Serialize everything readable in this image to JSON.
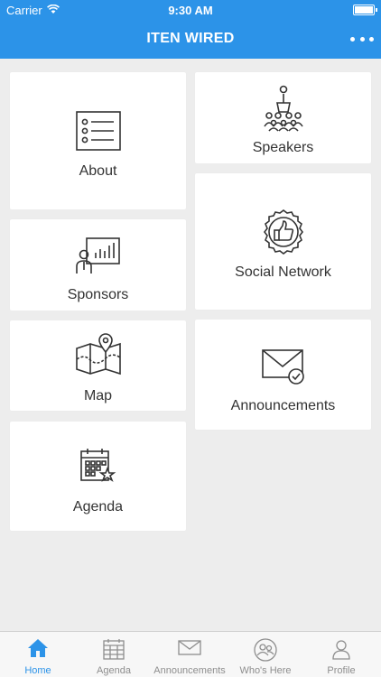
{
  "status_bar": {
    "carrier": "Carrier",
    "time": "9:30 AM"
  },
  "header": {
    "title": "ITEN WIRED"
  },
  "tiles": {
    "about": "About",
    "speakers": "Speakers",
    "sponsors": "Sponsors",
    "social_network": "Social Network",
    "map": "Map",
    "announcements": "Announcements",
    "agenda": "Agenda"
  },
  "tab_bar": {
    "items": [
      {
        "label": "Home",
        "icon": "home-icon",
        "active": true
      },
      {
        "label": "Agenda",
        "icon": "calendar-icon",
        "active": false
      },
      {
        "label": "Announcements",
        "icon": "envelope-icon",
        "active": false
      },
      {
        "label": "Who's Here",
        "icon": "people-icon",
        "active": false
      },
      {
        "label": "Profile",
        "icon": "person-icon",
        "active": false
      }
    ]
  },
  "colors": {
    "accent": "#2c93e8",
    "background": "#ededed",
    "inactive": "#8e8e8e"
  }
}
